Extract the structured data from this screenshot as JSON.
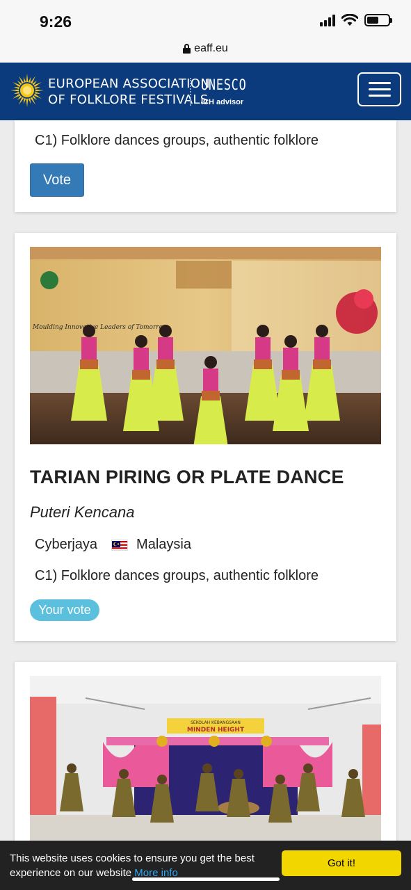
{
  "status_bar": {
    "time": "9:26",
    "battery_level": 0.55
  },
  "browser": {
    "url": "eaff.eu"
  },
  "header": {
    "brand_line1": "EUROPEAN ASSOCIATION",
    "brand_line2": "OF FOLKLORE FESTIVALS",
    "unesco_label": "UNESCO",
    "ich_label": "ICH advisor",
    "colors": {
      "header_bg": "#0b3b7c",
      "logo_yellow": "#f5c518"
    }
  },
  "cards": [
    {
      "category": "C1) Folklore dances groups, authentic folklore",
      "vote_label": "Vote"
    },
    {
      "title": "TARIAN PIRING OR PLATE DANCE",
      "subtitle": "Puteri Kencana",
      "city": "Cyberjaya",
      "country": "Malaysia",
      "category": "C1) Folklore dances groups, authentic folklore",
      "vote_label": "Your vote",
      "photo_banner_text": "Moulding Innovative Leaders of Tomorrow"
    },
    {
      "photo_banner_text": "MINDEN HEIGHT",
      "photo_banner_small": "SEKOLAH KEBANGSAAN"
    }
  ],
  "cookie": {
    "text": "This website uses cookies to ensure you get the best experience on our website",
    "link": "More info",
    "button": "Got it!"
  }
}
